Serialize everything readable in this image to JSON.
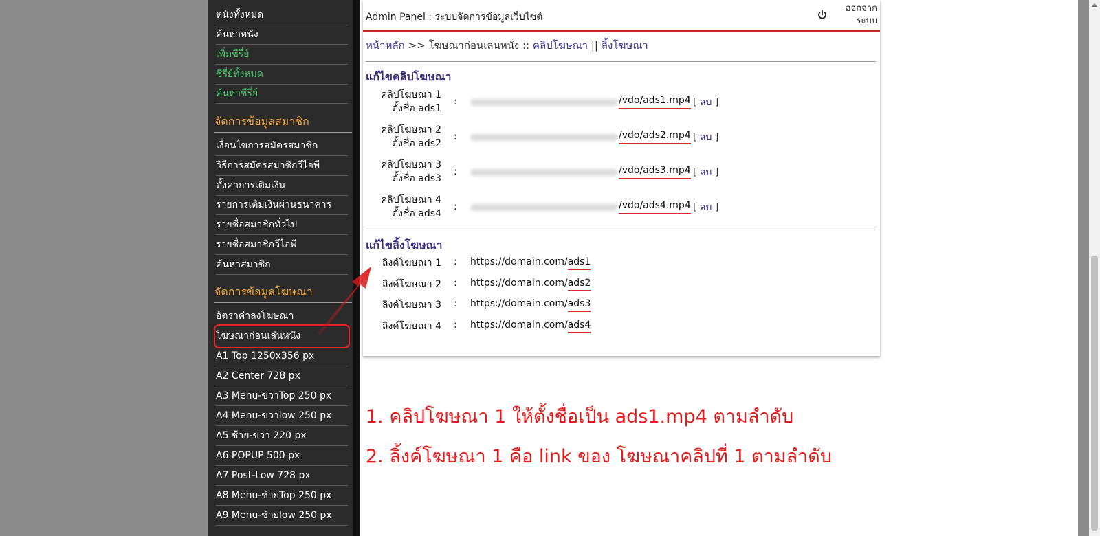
{
  "sidebar": {
    "movie_items": [
      {
        "label": "หนังทั้งหมด",
        "color": "white"
      },
      {
        "label": "ค้นหาหนัง",
        "color": "white"
      },
      {
        "label": "เพิ่มซีรี่ย์",
        "color": "green"
      },
      {
        "label": "ซีรี่ย์ทั้งหมด",
        "color": "green"
      },
      {
        "label": "ค้นหาซีรี่ย์",
        "color": "green"
      }
    ],
    "member_header": "จัดการข้อมูลสมาชิก",
    "member_items": [
      "เงื่อนไขการสมัครสมาชิก",
      "วิธีการสมัครสมาชิกวีไอพี",
      "ตั้งค่าการเติมเงิน",
      "รายการเติมเงินผ่านธนาคาร",
      "รายชื่อสมาชิกทั่วไป",
      "รายชื่อสมาชิกวีไอพี",
      "ค้นหาสมาชิก"
    ],
    "ads_header": "จัดการข้อมูลโฆษณา",
    "ads_items": [
      "อัตราค่าลงโฆษณา",
      "โฆษณาก่อนเล่นหนัง",
      "A1 Top 1250x356 px",
      "A2 Center 728 px",
      "A3 Menu-ขวาTop 250 px",
      "A4 Menu-ขวาlow 250 px",
      "A5 ซ้าย-ขวา 220 px",
      "A6 POPUP 500 px",
      "A7 Post-Low 728 px",
      "A8 Menu-ซ้ายTop 250 px",
      "A9 Menu-ซ้ายlow 250 px"
    ],
    "active_item": "โฆษณาก่อนเล่นหนัง"
  },
  "header": {
    "title": "Admin Panel : ระบบจัดการข้อมูลเว็บไซต์",
    "logout_line1": "ออกจาก",
    "logout_line2": "ระบบ",
    "power_icon": "power-icon"
  },
  "breadcrumb": {
    "home": "หน้าหลัก",
    "sep1": ">>",
    "current": "โฆษณาก่อนเล่นหนัง",
    "sep2": "::",
    "link1": "คลิปโฆษณา",
    "sep3": "||",
    "link2": "ลิ้งโฆษณา"
  },
  "clips": {
    "title": "แก้ไขคลิปโฆษณา",
    "rows": [
      {
        "label1": "คลิปโฆษณา 1",
        "label2": "ตั้งชื่อ ads1",
        "colon": ":",
        "path": "/vdo/ads1.mp4",
        "del_open": "[",
        "del": "ลบ",
        "del_close": "]"
      },
      {
        "label1": "คลิปโฆษณา 2",
        "label2": "ตั้งชื่อ ads2",
        "colon": ":",
        "path": "/vdo/ads2.mp4",
        "del_open": "[",
        "del": "ลบ",
        "del_close": "]"
      },
      {
        "label1": "คลิปโฆษณา 3",
        "label2": "ตั้งชื่อ ads3",
        "colon": ":",
        "path": "/vdo/ads3.mp4",
        "del_open": "[",
        "del": "ลบ",
        "del_close": "]"
      },
      {
        "label1": "คลิปโฆษณา 4",
        "label2": "ตั้งชื่อ ads4",
        "colon": ":",
        "path": "/vdo/ads4.mp4",
        "del_open": "[",
        "del": "ลบ",
        "del_close": "]"
      }
    ]
  },
  "links": {
    "title": "แก้ไขลิ้งโฆษณา",
    "rows": [
      {
        "label": "ลิงค์โฆษณา 1",
        "colon": ":",
        "base": "https://domain.com/",
        "slug": "ads1"
      },
      {
        "label": "ลิงค์โฆษณา 2",
        "colon": ":",
        "base": "https://domain.com/",
        "slug": "ads2"
      },
      {
        "label": "ลิงค์โฆษณา 3",
        "colon": ":",
        "base": "https://domain.com/",
        "slug": "ads3"
      },
      {
        "label": "ลิงค์โฆษณา 4",
        "colon": ":",
        "base": "https://domain.com/",
        "slug": "ads4"
      }
    ]
  },
  "notes": {
    "line1": "1. คลิปโฆษณา 1 ให้ตั้งชื่อเป็น ads1.mp4 ตามลำดับ",
    "line2": "2. ลิ้งค์โฆษณา 1 คือ link ของ โฆษณาคลิปที่ 1 ตามลำดับ"
  },
  "colors": {
    "sidebar_bg": "#2b2b2b",
    "sidebar_header": "#f0a43a",
    "green_text": "#4ec26a",
    "accent_red": "#c8232c",
    "link_purple": "#3a3598",
    "note_red": "#e41b1b"
  }
}
